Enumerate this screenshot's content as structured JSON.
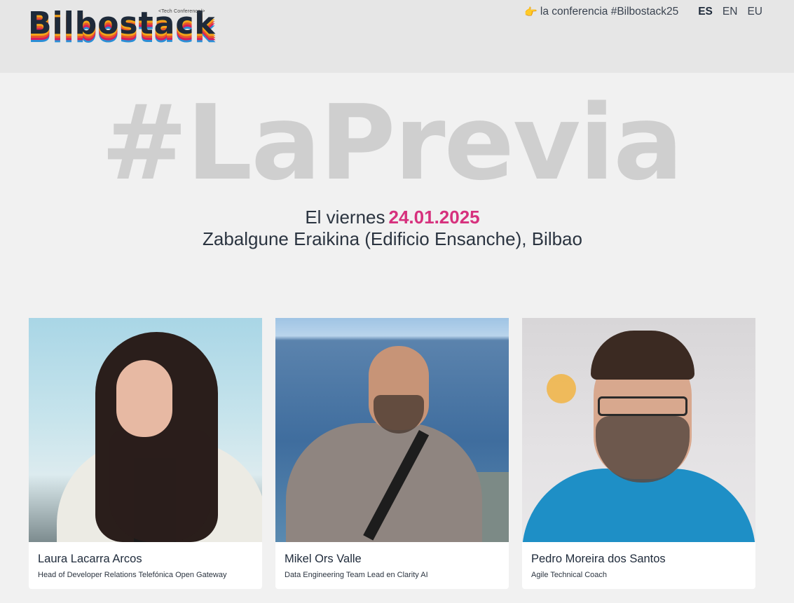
{
  "header": {
    "logo_text": "Bilbostack",
    "logo_tagline": "<Tech Conference/>",
    "conference_link": "la conferencia #Bilbostack25",
    "conference_icon": "pointing-hand-icon",
    "languages": [
      {
        "code": "ES",
        "active": true
      },
      {
        "code": "EN",
        "active": false
      },
      {
        "code": "EU",
        "active": false
      }
    ]
  },
  "hero": {
    "title": "#LaPrevia",
    "date_prefix": "El viernes",
    "date": "24.01.2025",
    "venue": "Zabalgune Eraikina (Edificio Ensanche), Bilbao"
  },
  "colors": {
    "accent": "#d6317d",
    "hero_title": "#cfcfcf",
    "text": "#2b3440"
  },
  "speakers": [
    {
      "name": "Laura Lacarra Arcos",
      "role": "Head of Developer Relations Telefónica Open Gateway"
    },
    {
      "name": "Mikel Ors Valle",
      "role": "Data Engineering Team Lead en Clarity AI"
    },
    {
      "name": "Pedro Moreira dos Santos",
      "role": "Agile Technical Coach"
    }
  ]
}
